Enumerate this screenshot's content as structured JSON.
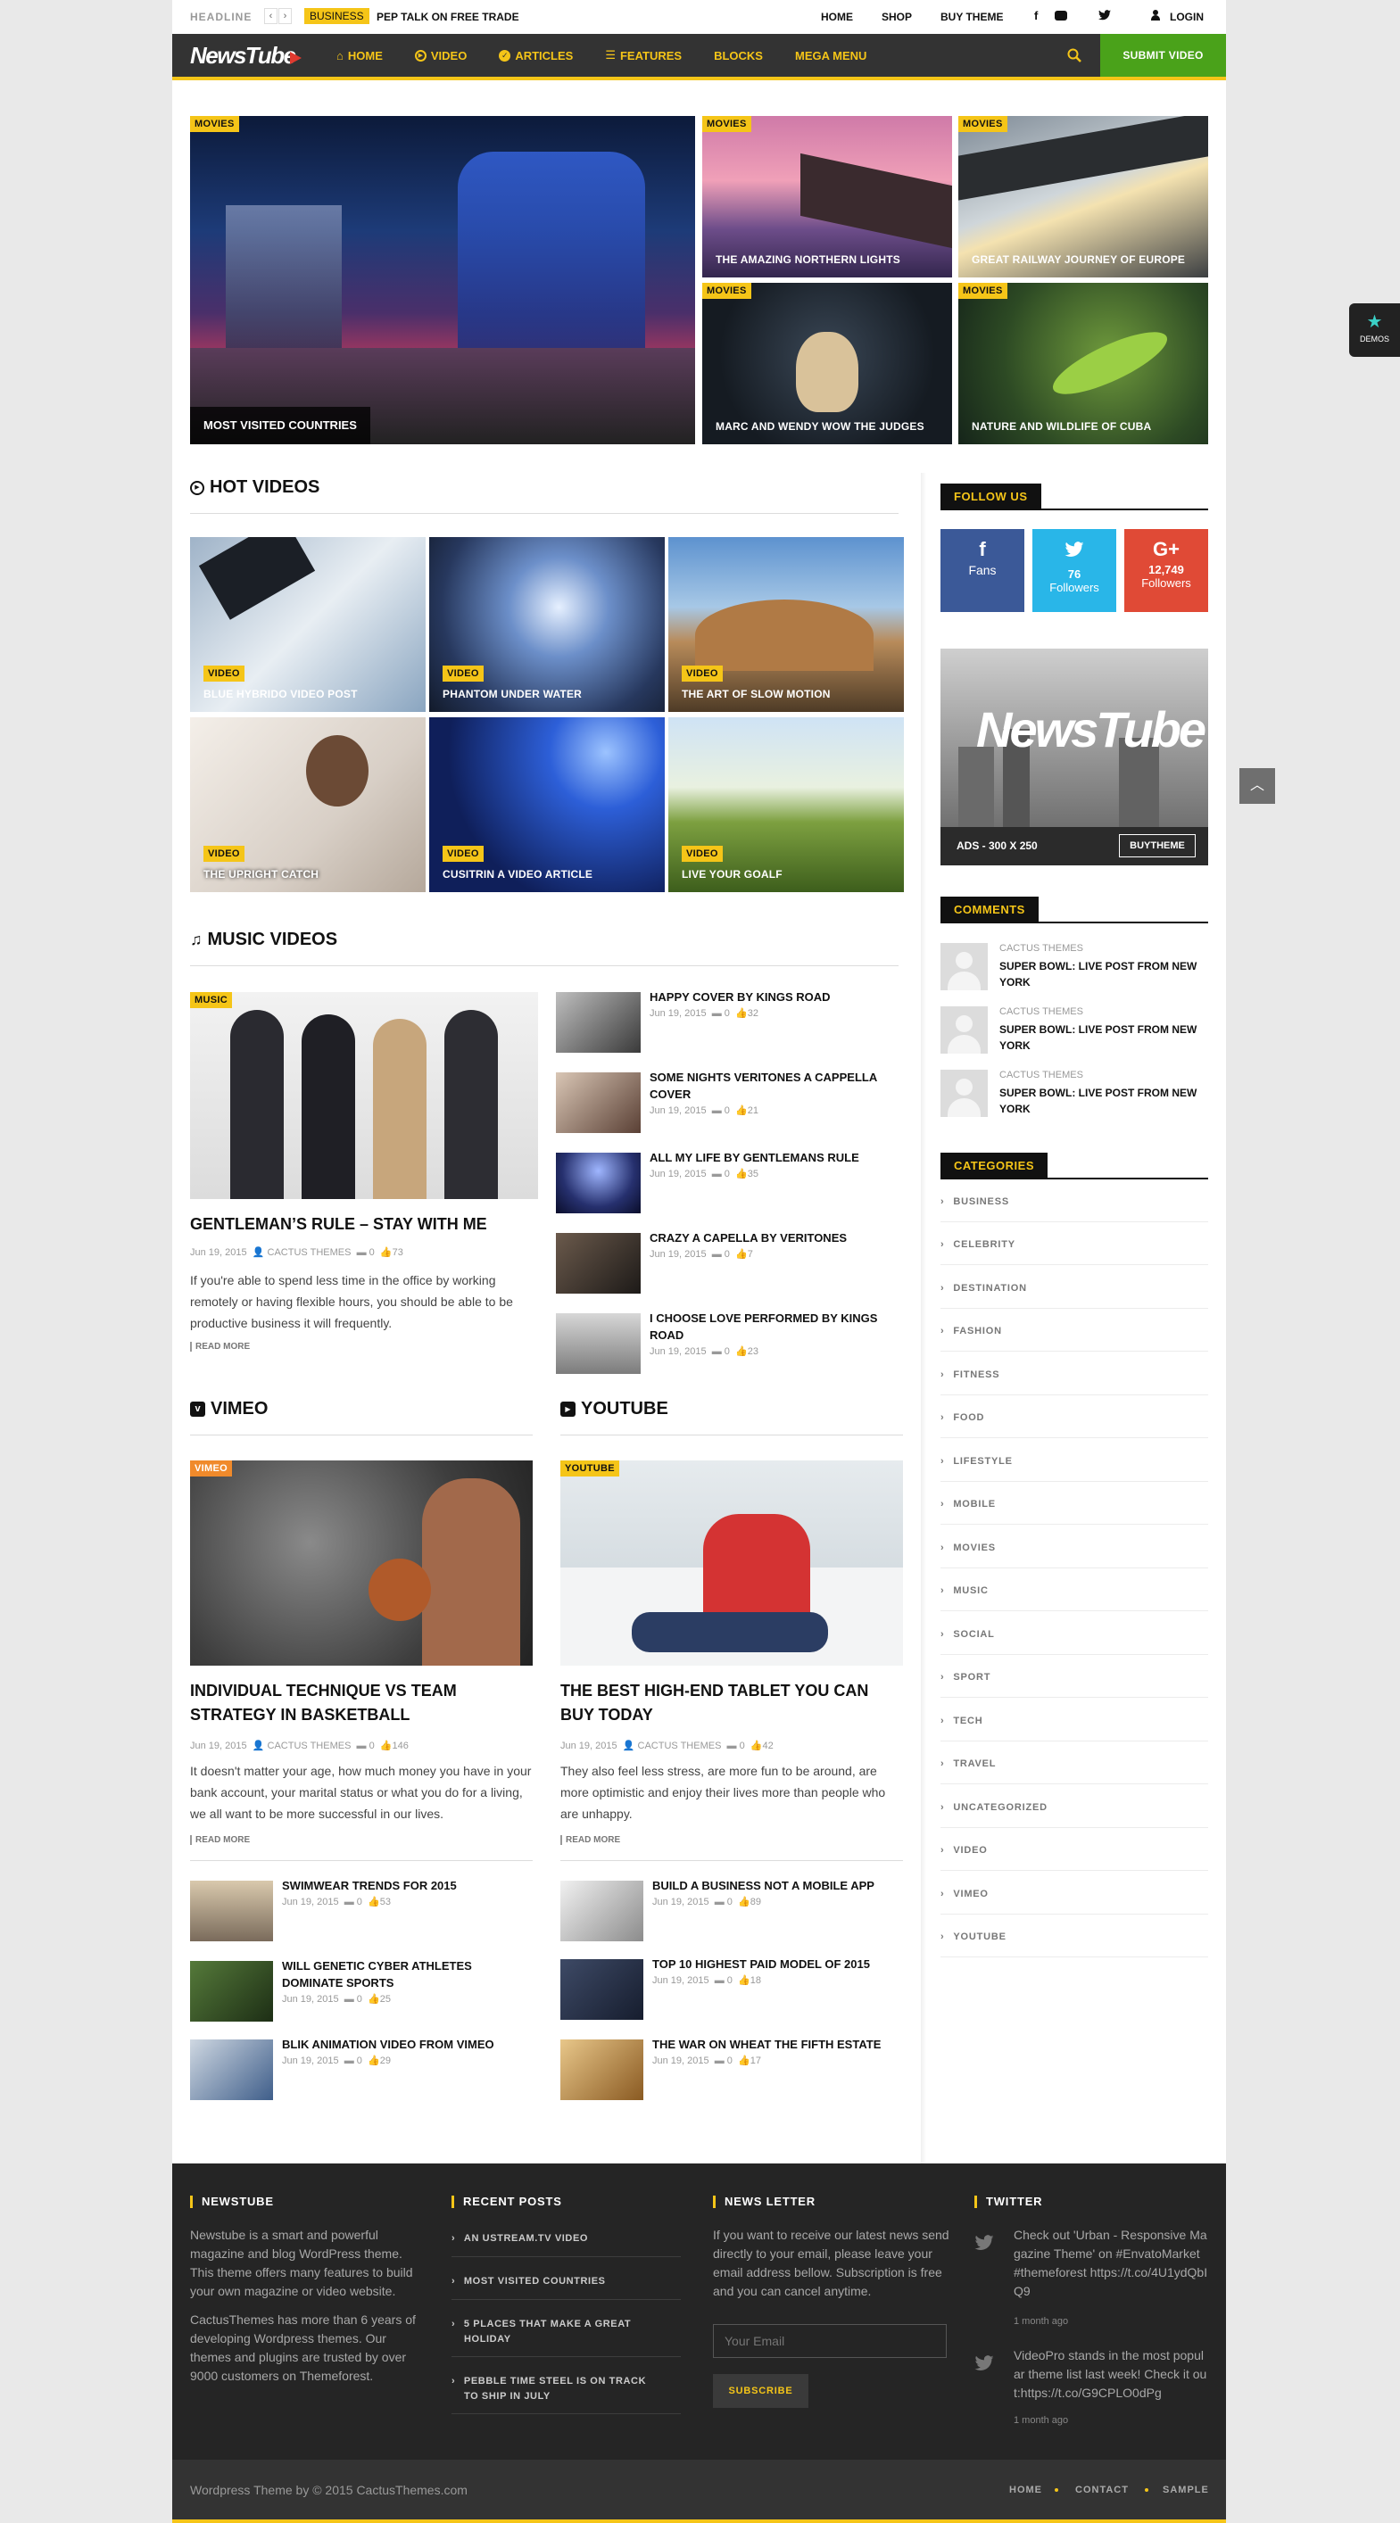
{
  "topbar": {
    "headline_label": "HEADLINE",
    "headline_tag": "BUSINESS",
    "headline_text": "PEP TALK ON FREE TRADE",
    "links": [
      "HOME",
      "SHOP",
      "BUY THEME"
    ],
    "login": "LOGIN"
  },
  "nav": {
    "logo": "NewsTube",
    "items": [
      "HOME",
      "VIDEO",
      "ARTICLES",
      "FEATURES",
      "BLOCKS",
      "MEGA MENU"
    ],
    "submit": "SUBMIT VIDEO"
  },
  "demos_label": "DEMOS",
  "featured": [
    {
      "tag": "MOVIES",
      "title": "MOST VISITED COUNTRIES"
    },
    {
      "tag": "MOVIES",
      "title": "THE AMAZING NORTHERN LIGHTS"
    },
    {
      "tag": "MOVIES",
      "title": "GREAT RAILWAY JOURNEY OF EUROPE"
    },
    {
      "tag": "MOVIES",
      "title": "MARC AND WENDY WOW THE JUDGES"
    },
    {
      "tag": "MOVIES",
      "title": "NATURE AND WILDLIFE OF CUBA"
    }
  ],
  "hot_videos": {
    "title": "HOT VIDEOS",
    "items": [
      {
        "tag": "VIDEO",
        "title": "BLUE HYBRIDO VIDEO POST"
      },
      {
        "tag": "VIDEO",
        "title": "PHANTOM UNDER WATER"
      },
      {
        "tag": "VIDEO",
        "title": "THE ART OF SLOW MOTION"
      },
      {
        "tag": "VIDEO",
        "title": "THE UPRIGHT CATCH"
      },
      {
        "tag": "VIDEO",
        "title": "CUSITRIN A VIDEO ARTICLE"
      },
      {
        "tag": "VIDEO",
        "title": "LIVE YOUR GOALF"
      }
    ]
  },
  "music": {
    "title": "MUSIC VIDEOS",
    "main": {
      "tag": "MUSIC",
      "title": "GENTLEMAN’S RULE – STAY WITH ME",
      "date": "Jun 19, 2015",
      "author": "CACTUS THEMES",
      "comments": "0",
      "likes": "73",
      "excerpt": "If you're able to spend less time in the office by working remotely or having flexible hours, you should be able to be productive business it will frequently.",
      "read_more": "READ MORE"
    },
    "list": [
      {
        "title": "HAPPY COVER BY KINGS ROAD",
        "date": "Jun 19, 2015",
        "comments": "0",
        "likes": "32"
      },
      {
        "title": "SOME NIGHTS VERITONES A CAPPELLA COVER",
        "date": "Jun 19, 2015",
        "comments": "0",
        "likes": "21"
      },
      {
        "title": "ALL MY LIFE BY GENTLEMANS RULE",
        "date": "Jun 19, 2015",
        "comments": "0",
        "likes": "35"
      },
      {
        "title": "CRAZY A CAPELLA BY VERITONES",
        "date": "Jun 19, 2015",
        "comments": "0",
        "likes": "7"
      },
      {
        "title": "I CHOOSE LOVE PERFORMED BY KINGS ROAD",
        "date": "Jun 19, 2015",
        "comments": "0",
        "likes": "23"
      }
    ]
  },
  "vimeo": {
    "title": "VIMEO",
    "main": {
      "tag": "VIMEO",
      "title": "INDIVIDUAL TECHNIQUE VS TEAM STRATEGY IN BASKETBALL",
      "date": "Jun 19, 2015",
      "author": "CACTUS THEMES",
      "comments": "0",
      "likes": "146",
      "excerpt": "It doesn't matter your age, how much money you have in your bank account, your marital status or what you do for a living, we all want to be more successful in our lives.",
      "read_more": "READ MORE"
    },
    "list": [
      {
        "title": "SWIMWEAR TRENDS FOR 2015",
        "date": "Jun 19, 2015",
        "comments": "0",
        "likes": "53"
      },
      {
        "title": "WILL GENETIC CYBER ATHLETES DOMINATE SPORTS",
        "date": "Jun 19, 2015",
        "comments": "0",
        "likes": "25"
      },
      {
        "title": "BLIK ANIMATION VIDEO FROM VIMEO",
        "date": "Jun 19, 2015",
        "comments": "0",
        "likes": "29"
      }
    ]
  },
  "youtube": {
    "title": "YOUTUBE",
    "main": {
      "tag": "YOUTUBE",
      "title": "THE BEST HIGH-END TABLET YOU CAN BUY TODAY",
      "date": "Jun 19, 2015",
      "author": "CACTUS THEMES",
      "comments": "0",
      "likes": "42",
      "excerpt": "They also feel less stress, are more fun to be around, are more optimistic and enjoy their lives more than people who are unhappy.",
      "read_more": "READ MORE"
    },
    "list": [
      {
        "title": "BUILD A BUSINESS NOT A MOBILE APP",
        "date": "Jun 19, 2015",
        "comments": "0",
        "likes": "89"
      },
      {
        "title": "TOP 10 HIGHEST PAID MODEL OF 2015",
        "date": "Jun 19, 2015",
        "comments": "0",
        "likes": "18"
      },
      {
        "title": "THE WAR ON WHEAT THE FIFTH ESTATE",
        "date": "Jun 19, 2015",
        "comments": "0",
        "likes": "17"
      }
    ]
  },
  "sidebar": {
    "follow_title": "FOLLOW US",
    "social": [
      {
        "count": "",
        "label": "Fans",
        "color": "#3b5998"
      },
      {
        "count": "76",
        "label": "Followers",
        "color": "#29b6e8"
      },
      {
        "count": "12,749",
        "label": "Followers",
        "color": "#e04a36"
      }
    ],
    "ad": {
      "logo": "NewsTube",
      "label": "ADS - 300 X 250",
      "button": "BUYTHEME"
    },
    "comments_title": "COMMENTS",
    "comments": [
      {
        "author": "CACTUS THEMES",
        "title": "SUPER BOWL: LIVE POST FROM NEW YORK"
      },
      {
        "author": "CACTUS THEMES",
        "title": "SUPER BOWL: LIVE POST FROM NEW YORK"
      },
      {
        "author": "CACTUS THEMES",
        "title": "SUPER BOWL: LIVE POST FROM NEW YORK"
      }
    ],
    "categories_title": "CATEGORIES",
    "categories": [
      "BUSINESS",
      "CELEBRITY",
      "DESTINATION",
      "FASHION",
      "FITNESS",
      "FOOD",
      "LIFESTYLE",
      "MOBILE",
      "MOVIES",
      "MUSIC",
      "SOCIAL",
      "SPORT",
      "TECH",
      "TRAVEL",
      "UNCATEGORIZED",
      "VIDEO",
      "VIMEO",
      "YOUTUBE"
    ]
  },
  "footer": {
    "about_title": "NEWSTUBE",
    "about_p1": "Newstube is a smart and powerful magazine and blog WordPress theme. This theme offers many features to build your own magazine or video website.",
    "about_p2": "CactusThemes has more than 6 years of developing Wordpress themes. Our themes and plugins are trusted by over 9000 customers on Themeforest.",
    "recent_title": "RECENT POSTS",
    "recent": [
      "AN USTREAM.TV VIDEO",
      "MOST VISITED COUNTRIES",
      "5 PLACES THAT MAKE A GREAT HOLIDAY",
      "PEBBLE TIME STEEL IS ON TRACK TO SHIP IN JULY"
    ],
    "news_title": "NEWS LETTER",
    "news_text": "If you want to receive our latest news send directly to your email, please leave your email address bellow. Subscription is free and you can cancel anytime.",
    "email_placeholder": "Your Email",
    "subscribe": "SUBSCRIBE",
    "twitter_title": "TWITTER",
    "tweets": [
      {
        "text": "Check out 'Urban - Responsive Magazine Theme' on #EnvatoMarket #themeforest https://t.co/4U1ydQbIQ9",
        "time": "1 month ago"
      },
      {
        "text": "VideoPro stands in the most popular theme list last week! Check it out:https://t.co/G9CPLO0dPg",
        "time": "1 month ago"
      }
    ],
    "copyright": "Wordpress Theme by © 2015 CactusThemes.com",
    "links": [
      "HOME",
      "CONTACT",
      "SAMPLE"
    ]
  },
  "colors": {
    "accent": "#f5c518",
    "nav_bg": "#333333",
    "submit_bg": "#4aa21a",
    "footer_bg": "#252525"
  }
}
